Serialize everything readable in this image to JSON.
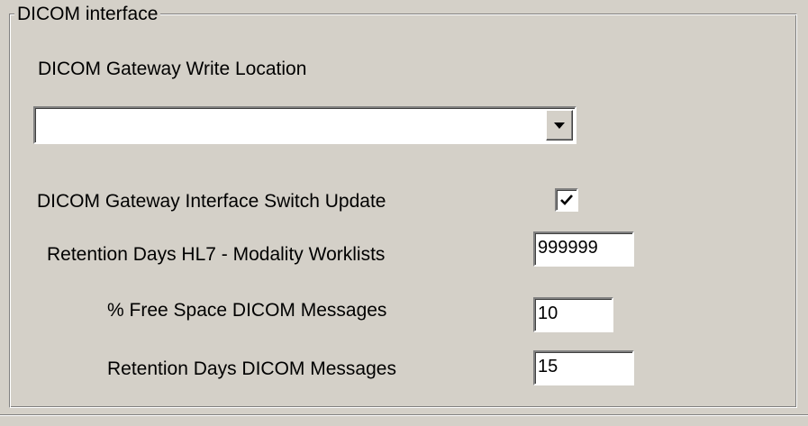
{
  "group": {
    "title": "DICOM interface"
  },
  "write_location": {
    "label": "DICOM Gateway Write Location",
    "value": ""
  },
  "switch_update": {
    "label": "DICOM Gateway  Interface Switch Update",
    "checked": true
  },
  "retention_hl7": {
    "label": "Retention Days HL7 - Modality Worklists",
    "value": "999999"
  },
  "free_space": {
    "label": "% Free Space DICOM Messages",
    "value": "10"
  },
  "retention_dicom": {
    "label": "Retention Days DICOM Messages",
    "value": "15"
  },
  "icons": {
    "dropdown": "chevron-down-icon",
    "check": "checkmark-icon"
  }
}
